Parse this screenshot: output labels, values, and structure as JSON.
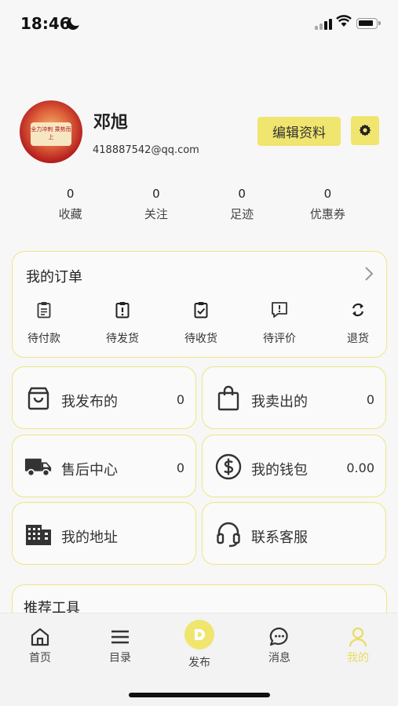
{
  "status": {
    "time": "18:46"
  },
  "profile": {
    "name": "邓旭",
    "email": "418887542@qq.com",
    "edit_label": "编辑资料",
    "avatar_text": "全力冲刺 乘势而上"
  },
  "stats": [
    {
      "value": "0",
      "label": "收藏"
    },
    {
      "value": "0",
      "label": "关注"
    },
    {
      "value": "0",
      "label": "足迹"
    },
    {
      "value": "0",
      "label": "优惠券"
    }
  ],
  "orders": {
    "title": "我的订单",
    "items": [
      {
        "label": "待付款",
        "icon": "clipboard-icon"
      },
      {
        "label": "待发货",
        "icon": "clipboard-alert-icon"
      },
      {
        "label": "待收货",
        "icon": "clipboard-check-icon"
      },
      {
        "label": "待评价",
        "icon": "comment-alert-icon"
      },
      {
        "label": "退货",
        "icon": "refresh-icon"
      }
    ]
  },
  "tiles": {
    "published": {
      "label": "我发布的",
      "value": "0",
      "icon": "shopping-bag-icon"
    },
    "sold": {
      "label": "我卖出的",
      "value": "0",
      "icon": "shopping-bag-icon"
    },
    "after_sales": {
      "label": "售后中心",
      "value": "0",
      "icon": "truck-icon"
    },
    "wallet": {
      "label": "我的钱包",
      "value": "0.00",
      "icon": "dollar-icon"
    },
    "address": {
      "label": "我的地址",
      "icon": "building-icon"
    },
    "support": {
      "label": "联系客服",
      "icon": "headset-icon"
    }
  },
  "tools": {
    "title": "推荐工具"
  },
  "tabs": [
    {
      "label": "首页",
      "icon": "home-icon"
    },
    {
      "label": "目录",
      "icon": "menu-icon"
    },
    {
      "label": "发布",
      "icon": "publish-icon"
    },
    {
      "label": "消息",
      "icon": "chat-icon"
    },
    {
      "label": "我的",
      "icon": "user-icon"
    }
  ],
  "colors": {
    "accent": "#f0e56e",
    "card_border": "#ece684",
    "active_tab": "#e8dd62"
  }
}
